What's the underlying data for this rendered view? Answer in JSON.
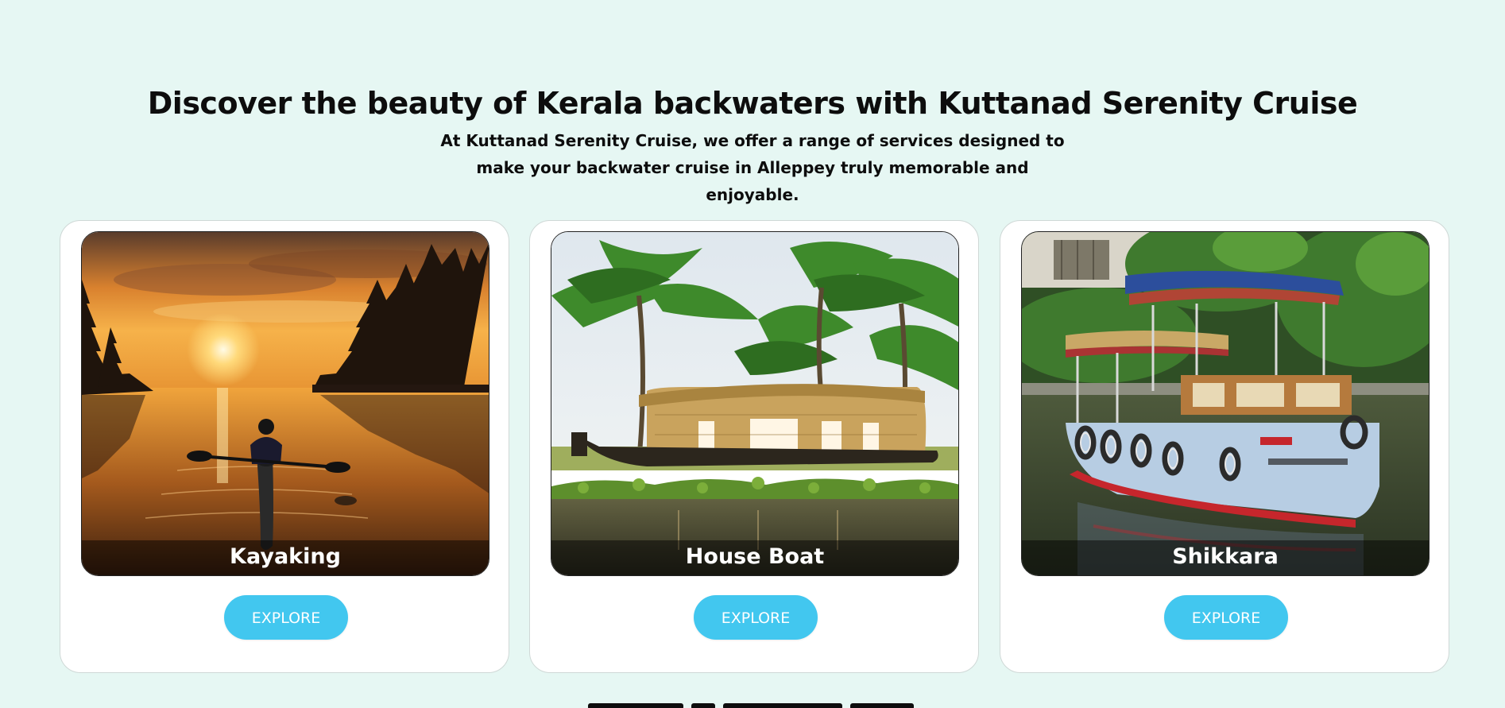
{
  "section": {
    "heading": "Discover the beauty of Kerala backwaters with Kuttanad Serenity Cruise",
    "subtext": "At Kuttanad Serenity Cruise, we offer a range of services designed to make your backwater cruise in Alleppey truly memorable and enjoyable."
  },
  "cards": [
    {
      "title": "Kayaking",
      "button_label": "EXPLORE",
      "image": "kayaker-at-sunset-photo"
    },
    {
      "title": "House Boat",
      "button_label": "EXPLORE",
      "image": "houseboat-under-palms-photo"
    },
    {
      "title": "Shikkara",
      "button_label": "EXPLORE",
      "image": "shikkara-boat-photo"
    }
  ],
  "colors": {
    "page_background": "#e6f7f3",
    "button": "#42c7ef",
    "card_background": "#ffffff"
  }
}
